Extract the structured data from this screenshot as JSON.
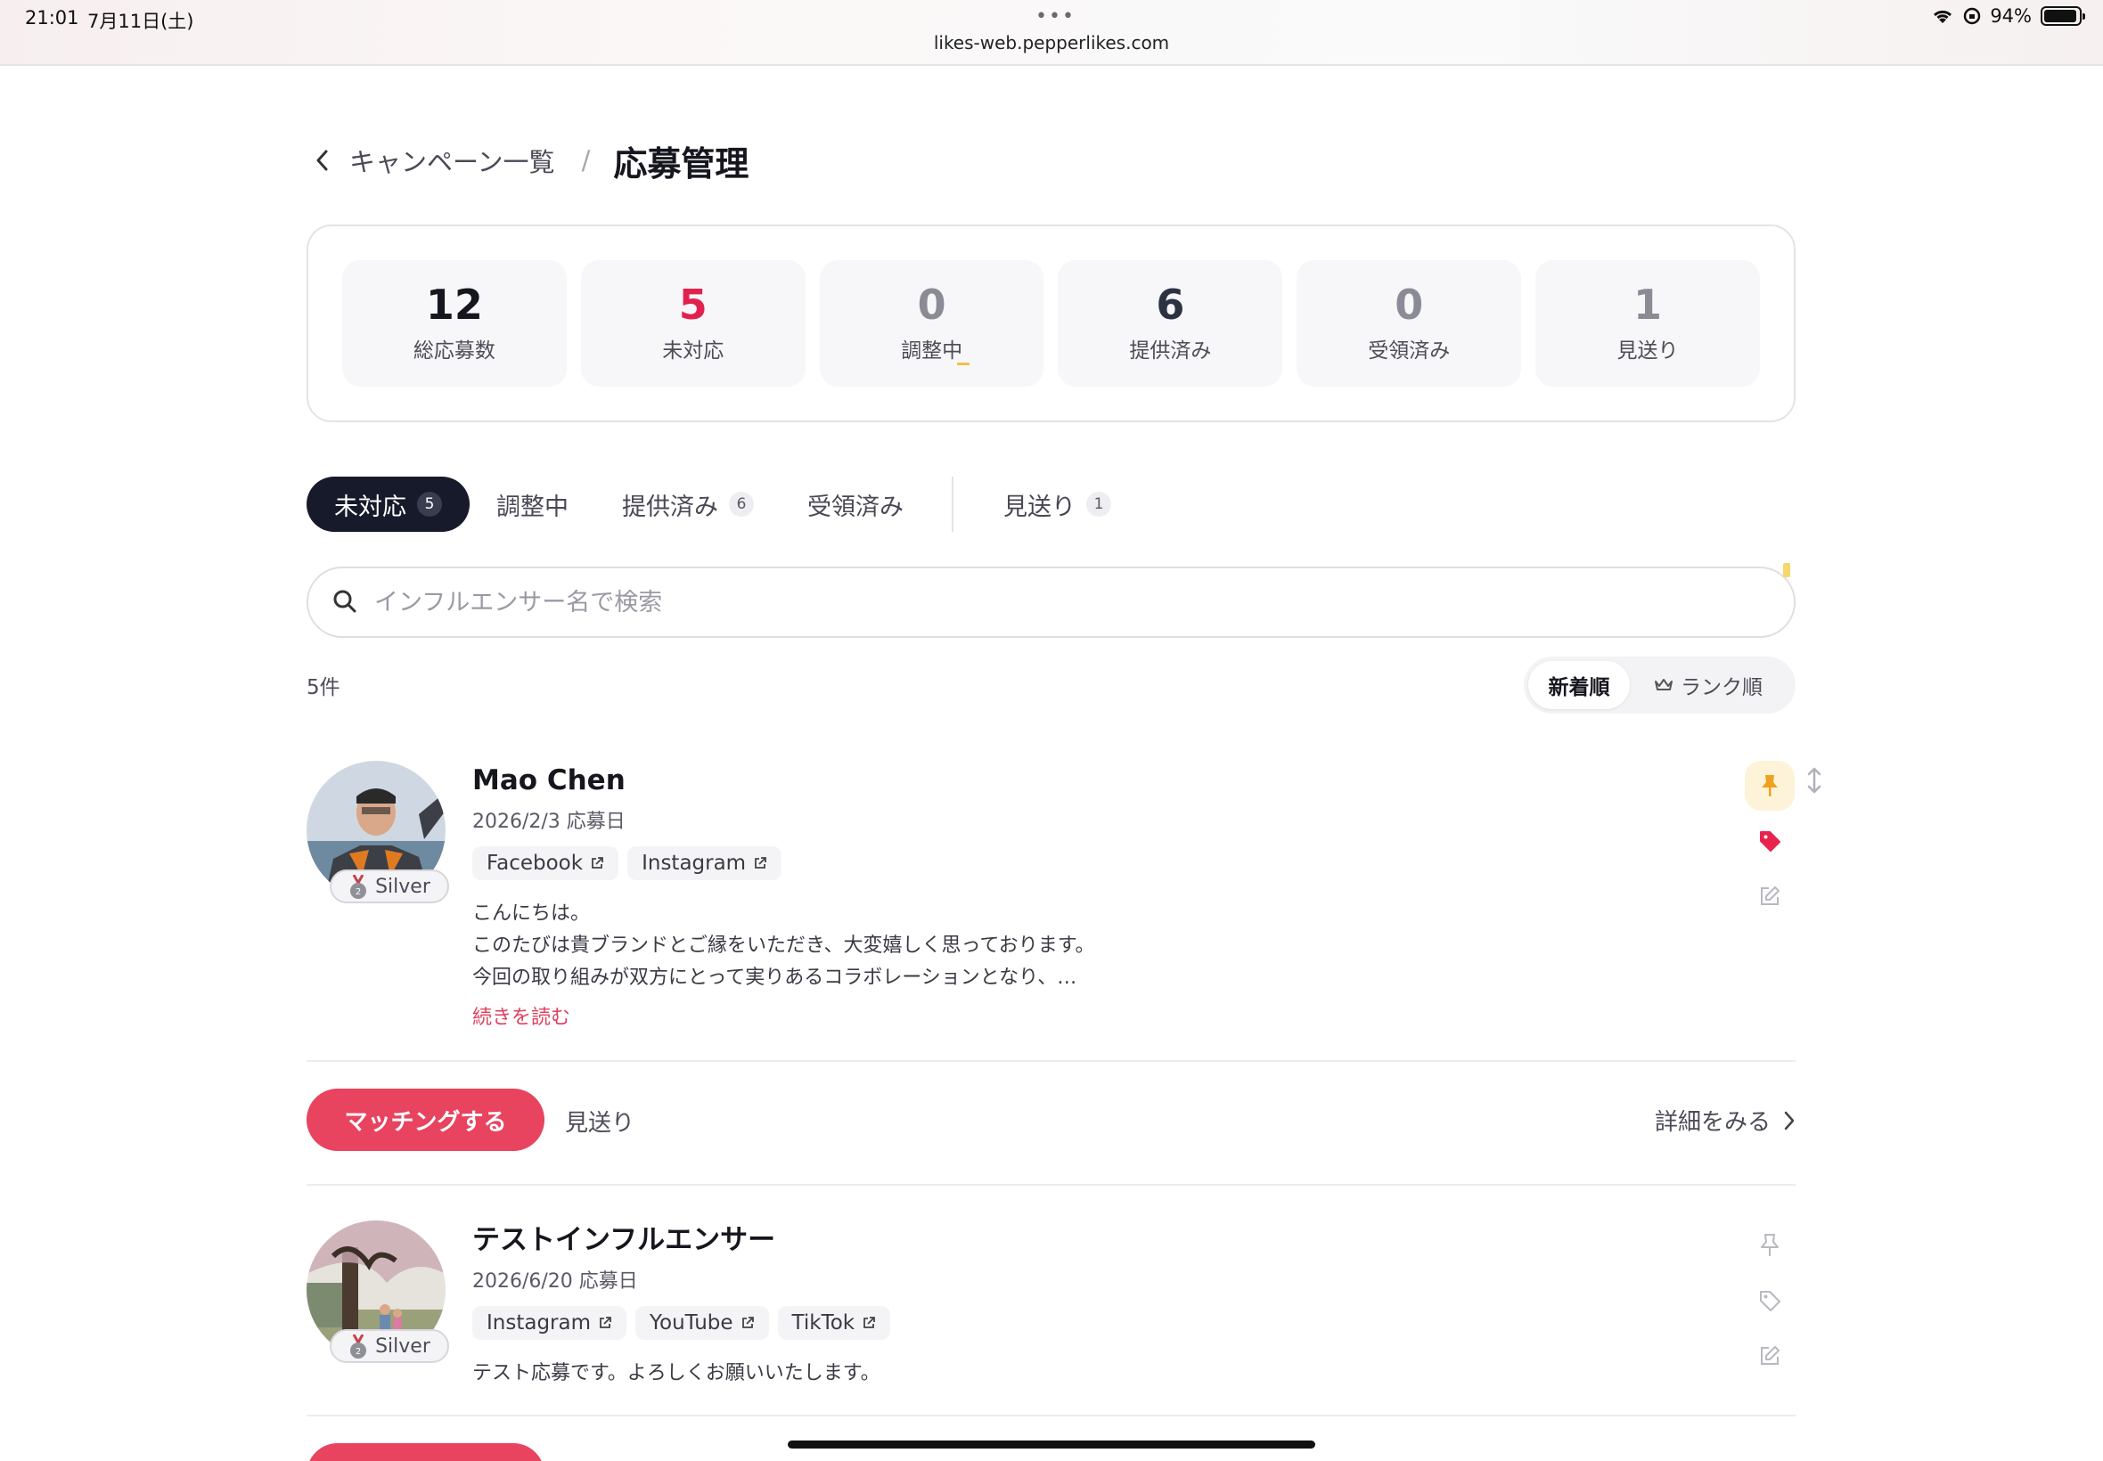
{
  "statusbar": {
    "time": "21:01",
    "date": "7月11日(土)",
    "dots": "•••",
    "url": "likes-web.pepperlikes.com",
    "battery_text": "94%",
    "battery_level": 0.94
  },
  "breadcrumb": {
    "parent": "キャンペーン一覧",
    "separator": "/",
    "current": "応募管理"
  },
  "stats": [
    {
      "value": "12",
      "label": "総応募数",
      "color": "#16161e"
    },
    {
      "value": "5",
      "label": "未対応",
      "color": "#e0234e"
    },
    {
      "value": "0",
      "label": "調整中",
      "color": "#8b8b96"
    },
    {
      "value": "6",
      "label": "提供済み",
      "color": "#2d3242"
    },
    {
      "value": "0",
      "label": "受領済み",
      "color": "#8b8b96"
    },
    {
      "value": "1",
      "label": "見送り",
      "color": "#8b8b96"
    }
  ],
  "tabs": [
    {
      "label": "未対応",
      "count": "5",
      "active": true
    },
    {
      "label": "調整中",
      "count": "",
      "active": false
    },
    {
      "label": "提供済み",
      "count": "6",
      "active": false
    },
    {
      "label": "受領済み",
      "count": "",
      "active": false
    },
    {
      "label": "見送り",
      "count": "1",
      "active": false
    }
  ],
  "search": {
    "placeholder": "インフルエンサー名で検索",
    "value": ""
  },
  "list": {
    "count_text": "5件",
    "sort": {
      "newest": "新着順",
      "rank": "ランク順"
    }
  },
  "applications": [
    {
      "name": "Mao Chen",
      "date": "2026/2/3 応募日",
      "rank": "Silver",
      "sns": [
        "Facebook",
        "Instagram"
      ],
      "message": "こんにちは。\nこのたびは貴ブランドとご縁をいただき、大変嬉しく思っております。\n今回の取り組みが双方にとって実りあるコラボレーションとなり、…",
      "read_more": "続きを読む",
      "pinned": true,
      "tagged": true
    },
    {
      "name": "テストインフルエンサー",
      "date": "2026/6/20 応募日",
      "rank": "Silver",
      "sns": [
        "Instagram",
        "YouTube",
        "TikTok"
      ],
      "message": "テスト応募です。よろしくお願いいたします。",
      "pinned": false,
      "tagged": false
    }
  ],
  "actions": {
    "match": "マッチングする",
    "pass": "見送り",
    "detail": "詳細をみる"
  },
  "colors": {
    "accent": "#e8435f",
    "dark": "#171a2a",
    "pin": "#f0a020",
    "tag": "#e8234e"
  }
}
